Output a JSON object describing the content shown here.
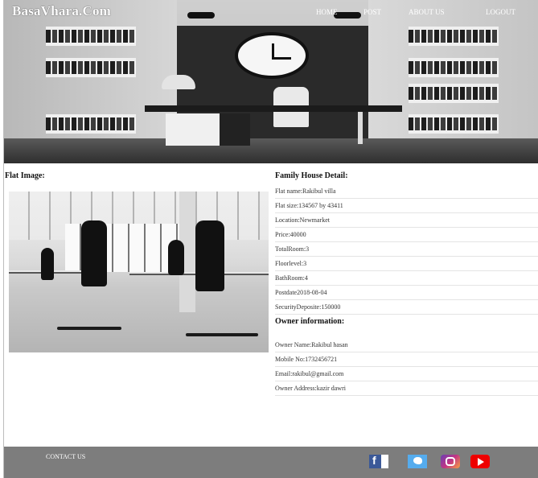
{
  "header": {
    "logo": "BasaVhara.Com",
    "nav": [
      {
        "label": "HOME"
      },
      {
        "label": "POST"
      },
      {
        "label": "ABOUT US"
      },
      {
        "label": "LOGOUT"
      }
    ]
  },
  "main": {
    "flat_image_title": "Flat Image:",
    "detail_title": "Family House Detail:",
    "details": [
      "Flat name:Rakibul villa",
      "Flat size:134567 by 43411",
      "Location:Newmarket",
      "Price:40000",
      "TotalRoom:3",
      "Floorlevel:3",
      "BathRoom:4",
      "Postdate2018-08-04",
      "SecurityDeposite:150000"
    ],
    "owner_title": "Owner information:",
    "owner": [
      "Owner Name:Rakibul hasan",
      "Mobile No:1732456721",
      "Email:rakibul@gmail.com",
      "Owner Address:kazir dawri"
    ]
  },
  "footer": {
    "contact_label": "CONTACT US",
    "social_icons": [
      "facebook-icon",
      "twitter-icon",
      "instagram-icon",
      "youtube-icon"
    ]
  },
  "colors": {
    "footer_bg": "#7d7d7d",
    "header_text": "#ffffff",
    "row_divider": "#e4e4e4"
  }
}
